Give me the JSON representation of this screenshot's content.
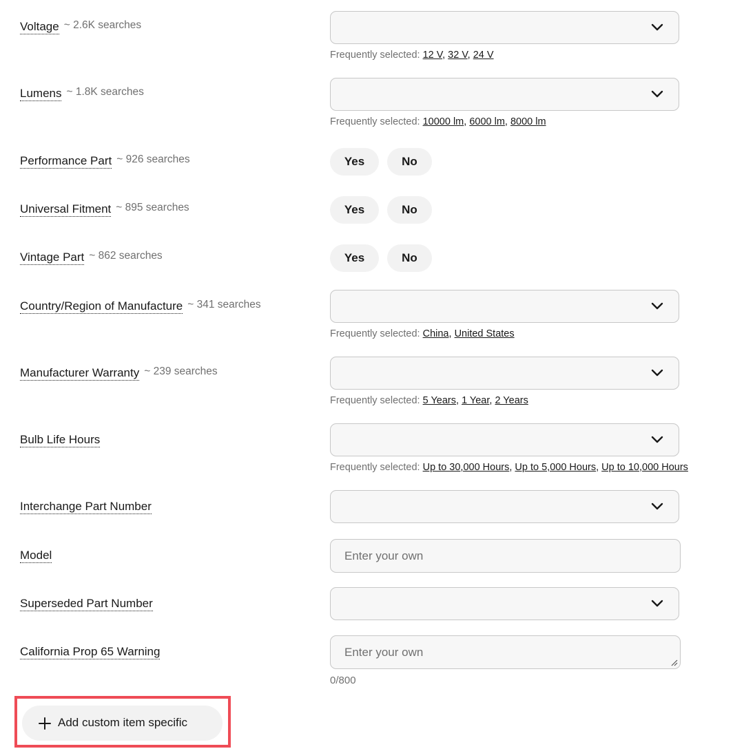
{
  "fields": [
    {
      "label": "Voltage",
      "searches": "~ 2.6K searches",
      "freq_prefix": "Frequently selected:",
      "options": [
        "12 V",
        "32 V",
        "24 V"
      ]
    },
    {
      "label": "Lumens",
      "searches": "~ 1.8K searches",
      "freq_prefix": "Frequently selected:",
      "options": [
        "10000 lm",
        "6000 lm",
        "8000 lm"
      ]
    },
    {
      "label": "Performance Part",
      "searches": "~ 926 searches",
      "yes": "Yes",
      "no": "No"
    },
    {
      "label": "Universal Fitment",
      "searches": "~ 895 searches",
      "yes": "Yes",
      "no": "No"
    },
    {
      "label": "Vintage Part",
      "searches": "~ 862 searches",
      "yes": "Yes",
      "no": "No"
    },
    {
      "label": "Country/Region of Manufacture",
      "searches": "~ 341 searches",
      "freq_prefix": "Frequently selected:",
      "options": [
        "China",
        "United States"
      ]
    },
    {
      "label": "Manufacturer Warranty",
      "searches": "~ 239 searches",
      "freq_prefix": "Frequently selected:",
      "options": [
        "5 Years",
        "1 Year",
        "2 Years"
      ]
    },
    {
      "label": "Bulb Life Hours",
      "freq_prefix": "Frequently selected:",
      "options": [
        "Up to 30,000 Hours",
        "Up to 5,000 Hours",
        "Up to 10,000 Hours"
      ]
    },
    {
      "label": "Interchange Part Number"
    },
    {
      "label": "Model",
      "placeholder": "Enter your own"
    },
    {
      "label": "Superseded Part Number"
    },
    {
      "label": "California Prop 65 Warning",
      "placeholder": "Enter your own",
      "counter": "0/800"
    }
  ],
  "add_custom_button": "Add custom item specific",
  "colors": {
    "highlight": "#ef4c56",
    "input_bg": "#f7f7f7",
    "pill_bg": "#f2f2f2",
    "muted_text": "#707070"
  }
}
